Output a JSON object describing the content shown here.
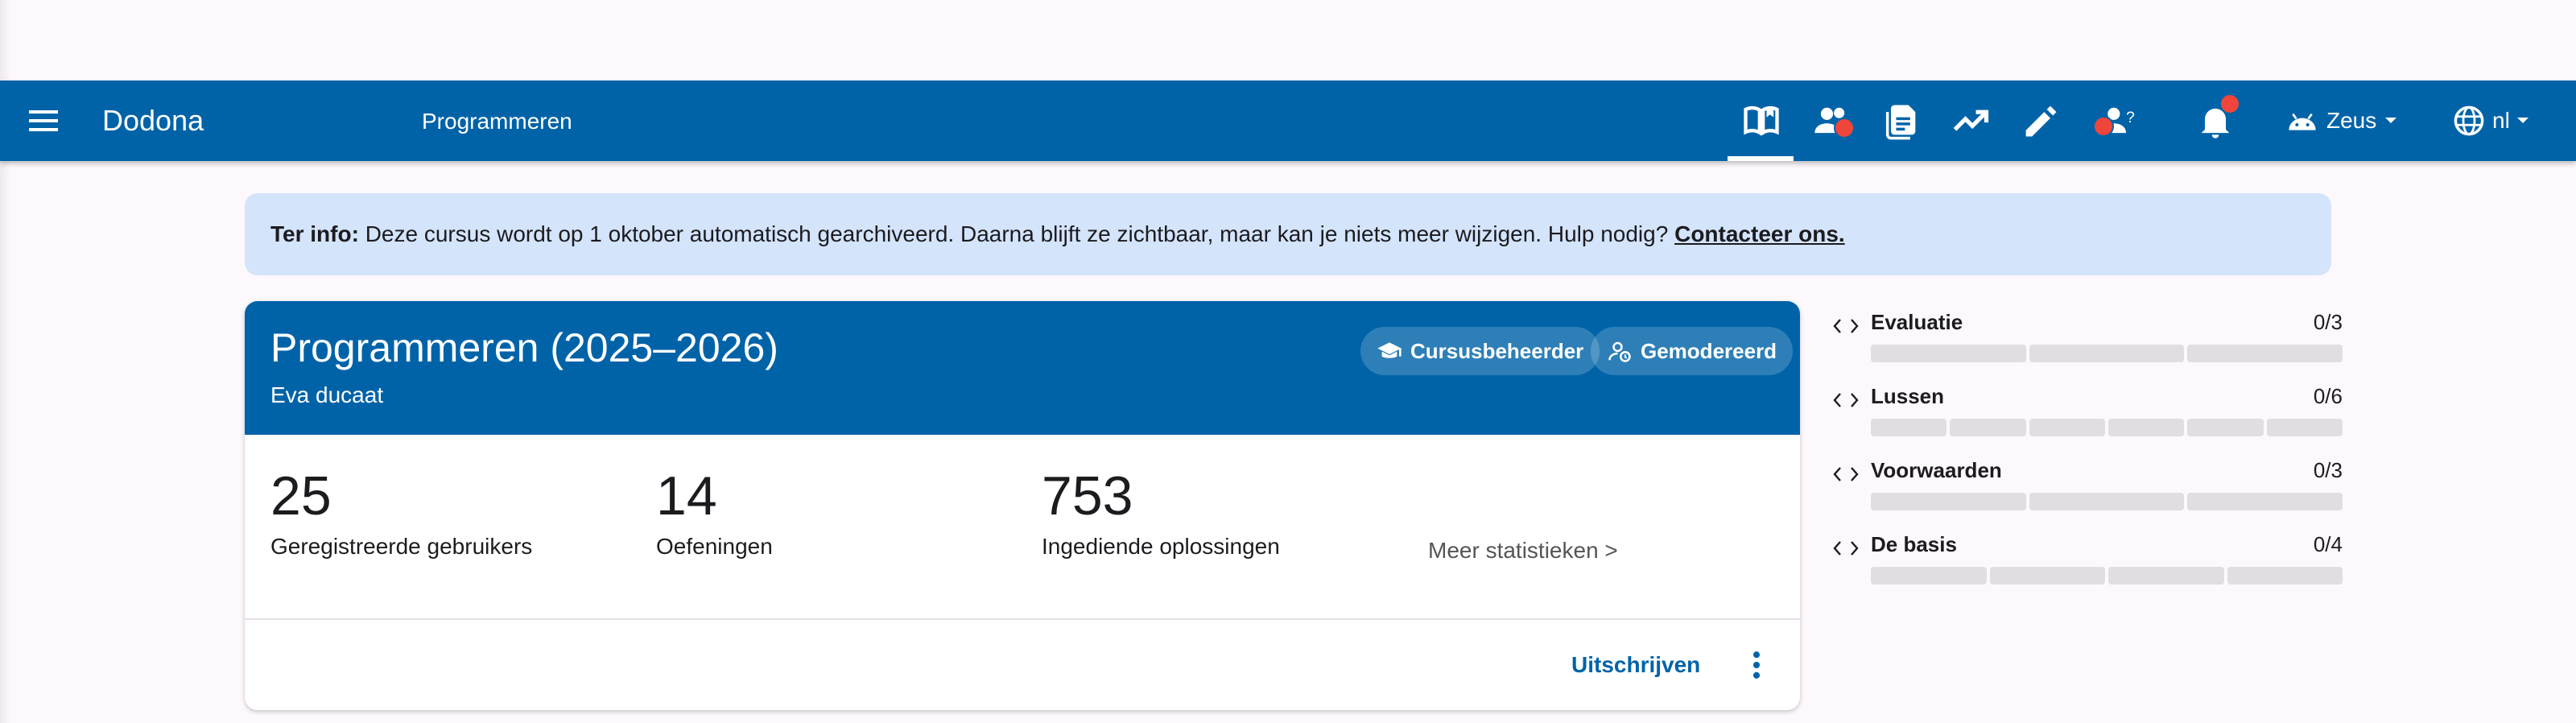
{
  "app": {
    "brand": "Dodona",
    "course": "Programmeren",
    "user": "Zeus",
    "language": "nl"
  },
  "nav_icons": [
    "book-open-icon",
    "users-icon",
    "document-icon",
    "trending-up-icon",
    "pencil-icon",
    "user-questions-icon",
    "bell-icon"
  ],
  "banner": {
    "prefix": "Ter info:",
    "text": " Deze cursus wordt op 1 oktober automatisch gearchiveerd. Daarna blijft ze zichtbaar, maar kan je niets meer wijzigen. Hulp nodig? ",
    "link": "Contacteer ons."
  },
  "card": {
    "title": "Programmeren (2025–2026)",
    "teacher": "Eva ducaat",
    "chip_admin": "Cursusbeheerder",
    "chip_moderated": "Gemodereerd",
    "stats": [
      {
        "value": "25",
        "label": "Geregistreerde gebruikers"
      },
      {
        "value": "14",
        "label": "Oefeningen"
      },
      {
        "value": "753",
        "label": "Ingediende oplossingen"
      }
    ],
    "more_stats": "Meer statistieken >",
    "unsubscribe": "Uitschrijven"
  },
  "series": [
    {
      "name": "Evaluatie",
      "score": "0/3",
      "segments": 3
    },
    {
      "name": "Lussen",
      "score": "0/6",
      "segments": 6
    },
    {
      "name": "Voorwaarden",
      "score": "0/3",
      "segments": 3
    },
    {
      "name": "De basis",
      "score": "0/4",
      "segments": 4
    }
  ],
  "colors": {
    "primary": "#0063a8",
    "banner": "#d3e4fb",
    "notification": "#f0453a",
    "progress_empty": "#e1dee3"
  }
}
